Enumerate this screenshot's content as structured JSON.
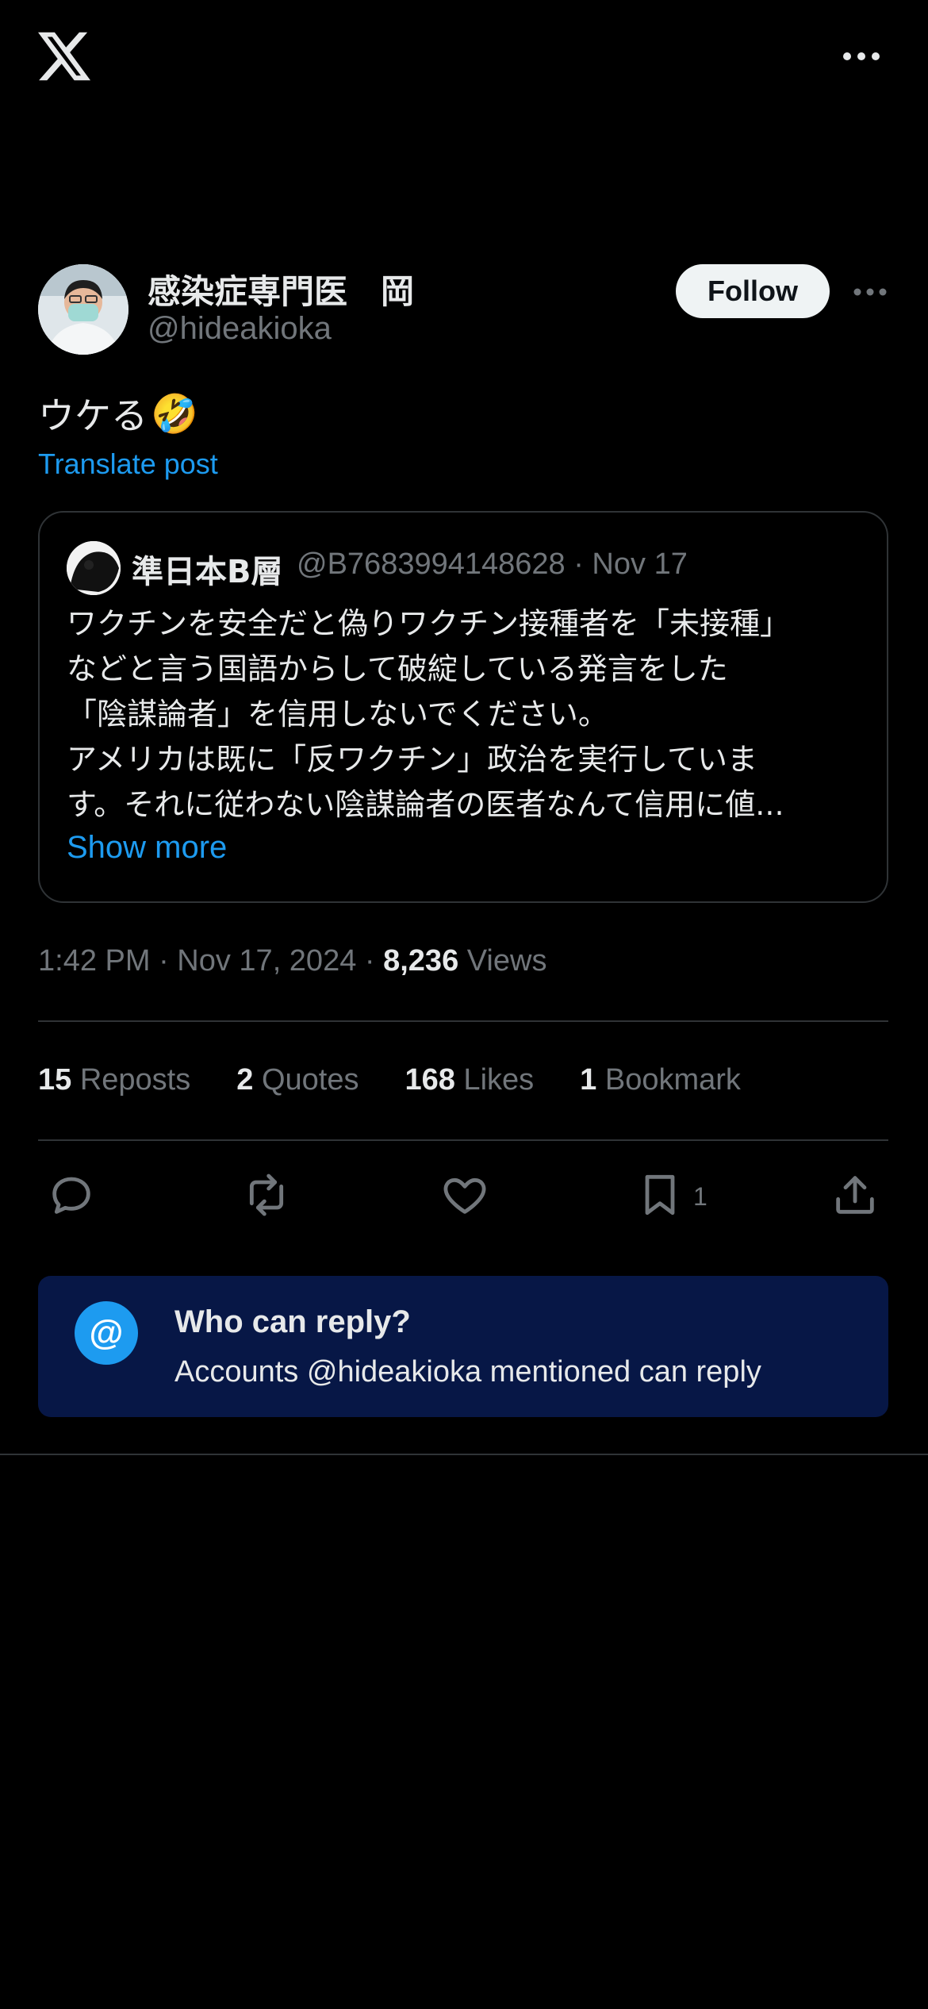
{
  "header": {
    "logo_icon": "x-logo-icon",
    "more_icon": "more-dots-icon"
  },
  "post": {
    "author_name": "感染症専門医　岡",
    "author_handle": "@hideakioka",
    "follow_label": "Follow",
    "text": "ウケる",
    "emoji": "🤣",
    "translate_label": "Translate post",
    "timestamp": "1:42 PM · Nov 17, 2024 · ",
    "views_count": "8,236",
    "views_label": " Views"
  },
  "quoted": {
    "name": "準日本B層",
    "meta": "@B7683994148628 · Nov 17",
    "lines": [
      "ワクチンを安全だと偽りワクチン接種者を「未接種」",
      "などと言う国語からして破綻している発言をした",
      "「陰謀論者」を信用しないでください。",
      "アメリカは既に「反ワクチン」政治を実行していま",
      "す。それに従わない陰謀論者の医者なんて信用に値..."
    ],
    "show_more": "Show more"
  },
  "stats": [
    {
      "count": "15",
      "label": " Reposts"
    },
    {
      "count": "2",
      "label": " Quotes"
    },
    {
      "count": "168",
      "label": " Likes"
    },
    {
      "count": "1",
      "label": " Bookmark"
    }
  ],
  "actions": {
    "reply_icon": "reply-icon",
    "repost_icon": "repost-icon",
    "like_icon": "like-icon",
    "bookmark_icon": "bookmark-icon",
    "bookmark_count": "1",
    "share_icon": "share-icon"
  },
  "reply_restriction": {
    "at_symbol": "@",
    "title": "Who can reply?",
    "description": "Accounts @hideakioka mentioned can reply"
  },
  "colors": {
    "accent": "#1d9bf0",
    "muted": "#71767b",
    "text": "#e7e9ea",
    "reply_bg": "#071746"
  }
}
